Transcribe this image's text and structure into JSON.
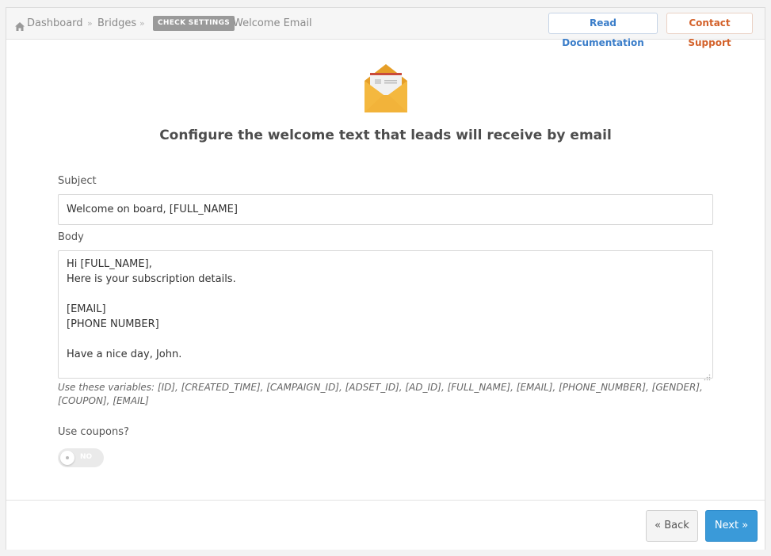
{
  "breadcrumb": {
    "items": [
      "Dashboard",
      "Bridges"
    ],
    "separator": "»",
    "badge": "CHECK SETTINGS",
    "current": "Welcome Email"
  },
  "header_buttons": {
    "docs": "Read Documentation",
    "support": "Contact Support"
  },
  "heading": "Configure the welcome text that leads will receive by email",
  "form": {
    "subject_label": "Subject",
    "subject_value": "Welcome on board, [FULL_NAME]",
    "body_label": "Body",
    "body_value": "Hi [FULL_NAME],\nHere is your subscription details.\n\n[EMAIL]\n[PHONE NUMBER]\n\nHave a nice day, John.",
    "variables_hint": "Use these variables: [ID], [CREATED_TIME], [CAMPAIGN_ID], [ADSET_ID], [AD_ID], [FULL_NAME], [EMAIL], [PHONE_NUMBER], [GENDER], [COUPON], [EMAIL]",
    "coupons_label": "Use coupons?",
    "coupons_toggle": "NO"
  },
  "footer": {
    "back_label": "« Back",
    "next_label": "Next »"
  },
  "colors": {
    "primary": "#3a9ad9",
    "docs_link": "#3a7dc9",
    "support_link": "#d3612a",
    "envelope": "#f2b33a"
  },
  "icons": [
    "home-icon",
    "envelope-icon",
    "resize-handle-icon"
  ]
}
